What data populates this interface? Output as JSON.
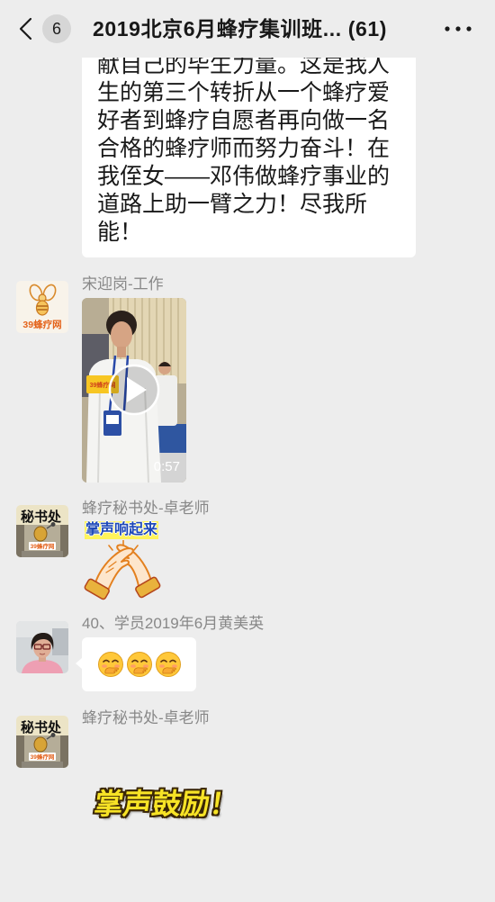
{
  "colors": {
    "background": "#ededed",
    "bubble": "#ffffff",
    "text": "#191919",
    "sender_name": "#888888",
    "badge": "#d6d6d6"
  },
  "header": {
    "back_icon": "chevron-left-icon",
    "unread_count": "6",
    "title": "2019北京6月蜂疗集训班... (61)",
    "more_icon": "more-dots-icon"
  },
  "messages": [
    {
      "text_lines": [
        "献自己的毕生力量。这是我人",
        "生的第三个转折从一个蜂疗爱",
        "好者到蜂疗自愿者再向做一名",
        "合格的蜂疗师而努力奋斗！在",
        "我侄女——邓伟做蜂疗事业的",
        "道路上助一臂之力！尽我所",
        "能！"
      ]
    },
    {
      "sender": "宋迎岗-工作",
      "avatar": {
        "logo_text": "39蜂疗网"
      },
      "video": {
        "logo_text": "39蜂疗网",
        "duration": "0:57",
        "play_icon": "play-icon"
      }
    },
    {
      "sender": "蜂疗秘书处-卓老师",
      "avatar": {
        "text": "秘书处",
        "logo_text": "39蜂疗网"
      },
      "sticker": {
        "text": "掌声响起来",
        "icon": "clapping-hands-icon"
      }
    },
    {
      "sender": "40、学员2019年6月黄美英",
      "avatar": {
        "icon": "user-photo-icon"
      },
      "emojis": [
        "face-with-hand-over-mouth-icon",
        "face-with-hand-over-mouth-icon",
        "face-with-hand-over-mouth-icon"
      ]
    },
    {
      "sender": "蜂疗秘书处-卓老师",
      "avatar": {
        "text": "秘书处",
        "logo_text": "39蜂疗网"
      },
      "sticker": {
        "text": "掌声鼓励！"
      }
    }
  ]
}
